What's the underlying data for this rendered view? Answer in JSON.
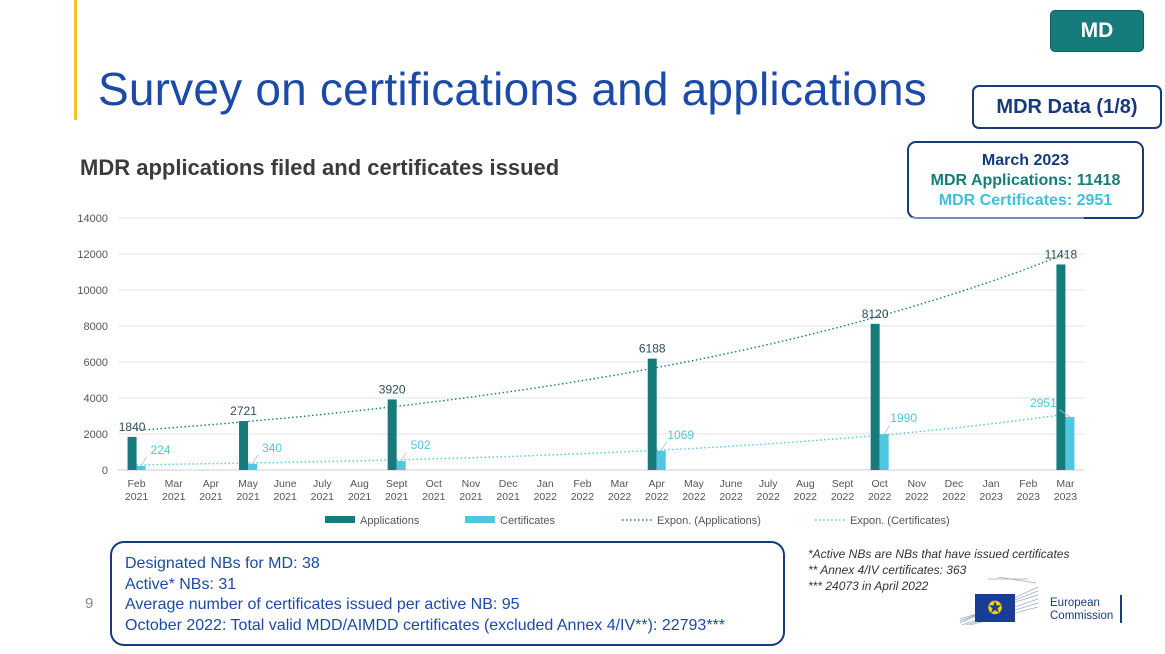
{
  "badge": "MD",
  "title": "Survey on certifications and applications",
  "mdr_data_label": "MDR Data (1/8)",
  "highlight": {
    "heading": "March 2023",
    "applications": "MDR Applications: 11418",
    "certificates": "MDR Certificates: 2951"
  },
  "colors": {
    "title": "#1b4aa8",
    "applications": "#167c7b",
    "certificates": "#4fc7df",
    "box_border": "#163a7a"
  },
  "chart_data": {
    "type": "bar",
    "title": "MDR applications filed and certificates issued",
    "categories": [
      [
        "Feb",
        "2021"
      ],
      [
        "Mar",
        "2021"
      ],
      [
        "Apr",
        "2021"
      ],
      [
        "May",
        "2021"
      ],
      [
        "June",
        "2021"
      ],
      [
        "July",
        "2021"
      ],
      [
        "Aug",
        "2021"
      ],
      [
        "Sept",
        "2021"
      ],
      [
        "Oct",
        "2021"
      ],
      [
        "Nov",
        "2021"
      ],
      [
        "Dec",
        "2021"
      ],
      [
        "Jan",
        "2022"
      ],
      [
        "Feb",
        "2022"
      ],
      [
        "Mar",
        "2022"
      ],
      [
        "Apr",
        "2022"
      ],
      [
        "May",
        "2022"
      ],
      [
        "June",
        "2022"
      ],
      [
        "July",
        "2022"
      ],
      [
        "Aug",
        "2022"
      ],
      [
        "Sept",
        "2022"
      ],
      [
        "Oct",
        "2022"
      ],
      [
        "Nov",
        "2022"
      ],
      [
        "Dec",
        "2022"
      ],
      [
        "Jan",
        "2023"
      ],
      [
        "Feb",
        "2023"
      ],
      [
        "Mar",
        "2023"
      ]
    ],
    "series": [
      {
        "name": "Applications",
        "values": [
          1840,
          null,
          null,
          2721,
          null,
          null,
          null,
          3920,
          null,
          null,
          null,
          null,
          null,
          null,
          6188,
          null,
          null,
          null,
          null,
          null,
          8120,
          null,
          null,
          null,
          null,
          11418
        ],
        "color": "#167c7b"
      },
      {
        "name": "Certificates",
        "values": [
          224,
          null,
          null,
          340,
          null,
          null,
          null,
          502,
          null,
          null,
          null,
          null,
          null,
          null,
          1069,
          null,
          null,
          null,
          null,
          null,
          1990,
          null,
          null,
          null,
          null,
          2951
        ],
        "color": "#4fc7df"
      }
    ],
    "trendlines": [
      {
        "name": "Expon. (Applications)",
        "start": 2200,
        "end": 12000,
        "color": "#167c7b"
      },
      {
        "name": "Expon. (Certificates)",
        "start": 290,
        "end": 3100,
        "color": "#4fc7df"
      }
    ],
    "y_ticks": [
      0,
      2000,
      4000,
      6000,
      8000,
      10000,
      12000,
      14000
    ],
    "ylim": [
      0,
      14000
    ],
    "legend_position": "bottom"
  },
  "info_lines": [
    "Designated NBs for MD: 38",
    "Active* NBs: 31",
    "Average number of certificates issued per active NB: 95",
    "October 2022: Total valid MDD/AIMDD certificates (excluded Annex 4/IV**): 22793***"
  ],
  "page_number": "9",
  "footnotes": [
    "*Active NBs are NBs that have issued certificates",
    "** Annex 4/IV certificates: 363",
    "*** 24073 in April 2022"
  ],
  "logo": {
    "line1": "European",
    "line2": "Commission",
    "icon": "eu-flag-icon"
  }
}
